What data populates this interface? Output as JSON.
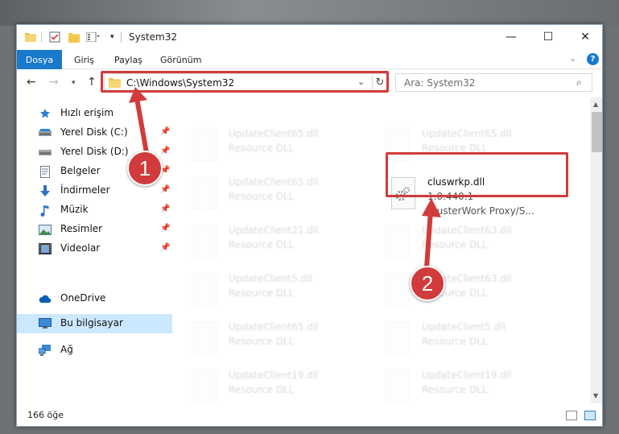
{
  "window": {
    "title": "System32",
    "controls": {
      "minimize": "—",
      "maximize": "☐",
      "close": "✕"
    }
  },
  "ribbon": {
    "file_tab": "Dosya",
    "tabs": [
      "Giriş",
      "Paylaş",
      "Görünüm"
    ],
    "help": "?"
  },
  "navigation": {
    "address_path": "C:\\Windows\\System32",
    "search_placeholder": "Ara: System32"
  },
  "sidebar": {
    "items": [
      {
        "label": "Hızlı erişim",
        "icon": "star-icon",
        "pinned": false
      },
      {
        "label": "Yerel Disk (C:)",
        "icon": "drive-icon",
        "pinned": true
      },
      {
        "label": "Yerel Disk (D:)",
        "icon": "drive-icon",
        "pinned": true
      },
      {
        "label": "Belgeler",
        "icon": "documents-icon",
        "pinned": true
      },
      {
        "label": "İndirmeler",
        "icon": "download-icon",
        "pinned": true
      },
      {
        "label": "Müzik",
        "icon": "music-icon",
        "pinned": true
      },
      {
        "label": "Resimler",
        "icon": "pictures-icon",
        "pinned": true
      },
      {
        "label": "Videolar",
        "icon": "videos-icon",
        "pinned": true
      },
      {
        "label": "OneDrive",
        "icon": "cloud-icon",
        "pinned": false
      },
      {
        "label": "Bu bilgisayar",
        "icon": "computer-icon",
        "pinned": false
      },
      {
        "label": "Ağ",
        "icon": "network-icon",
        "pinned": false
      }
    ]
  },
  "files": {
    "main": {
      "name": "cluswrkp.dll",
      "version": "1.0.440.1",
      "description": "ClusterWork Proxy/S..."
    },
    "background": [
      {
        "name": "UpdateClient65.dll",
        "type": "Resource DLL"
      },
      {
        "name": "UpdateClient65.dll",
        "type": "Resource DLL"
      },
      {
        "name": "UpdateClient65.dll",
        "type": "Resource DLL"
      },
      {
        "name": "UpdateClient21.dll",
        "type": "Resource DLL"
      },
      {
        "name": "UpdateClient63.dll",
        "type": "Resource DLL"
      },
      {
        "name": "UpdateClient5.dll",
        "type": "Resource DLL"
      },
      {
        "name": "UpdateClient63.dll",
        "type": "Resource DLL"
      },
      {
        "name": "UpdateClient65.dll",
        "type": "Resource DLL"
      },
      {
        "name": "UpdateClient5.dll",
        "type": "Resource DLL"
      },
      {
        "name": "UpdateClient19.dll",
        "type": "Resource DLL"
      },
      {
        "name": "UpdateClient19.dll",
        "type": "Resource DLL"
      }
    ]
  },
  "status": {
    "item_count": "166 öğe"
  },
  "annotations": {
    "marker1": "1",
    "marker2": "2"
  },
  "colors": {
    "accent": "#1979ca",
    "highlight": "#d23b3b",
    "selected": "#cce8ff"
  }
}
